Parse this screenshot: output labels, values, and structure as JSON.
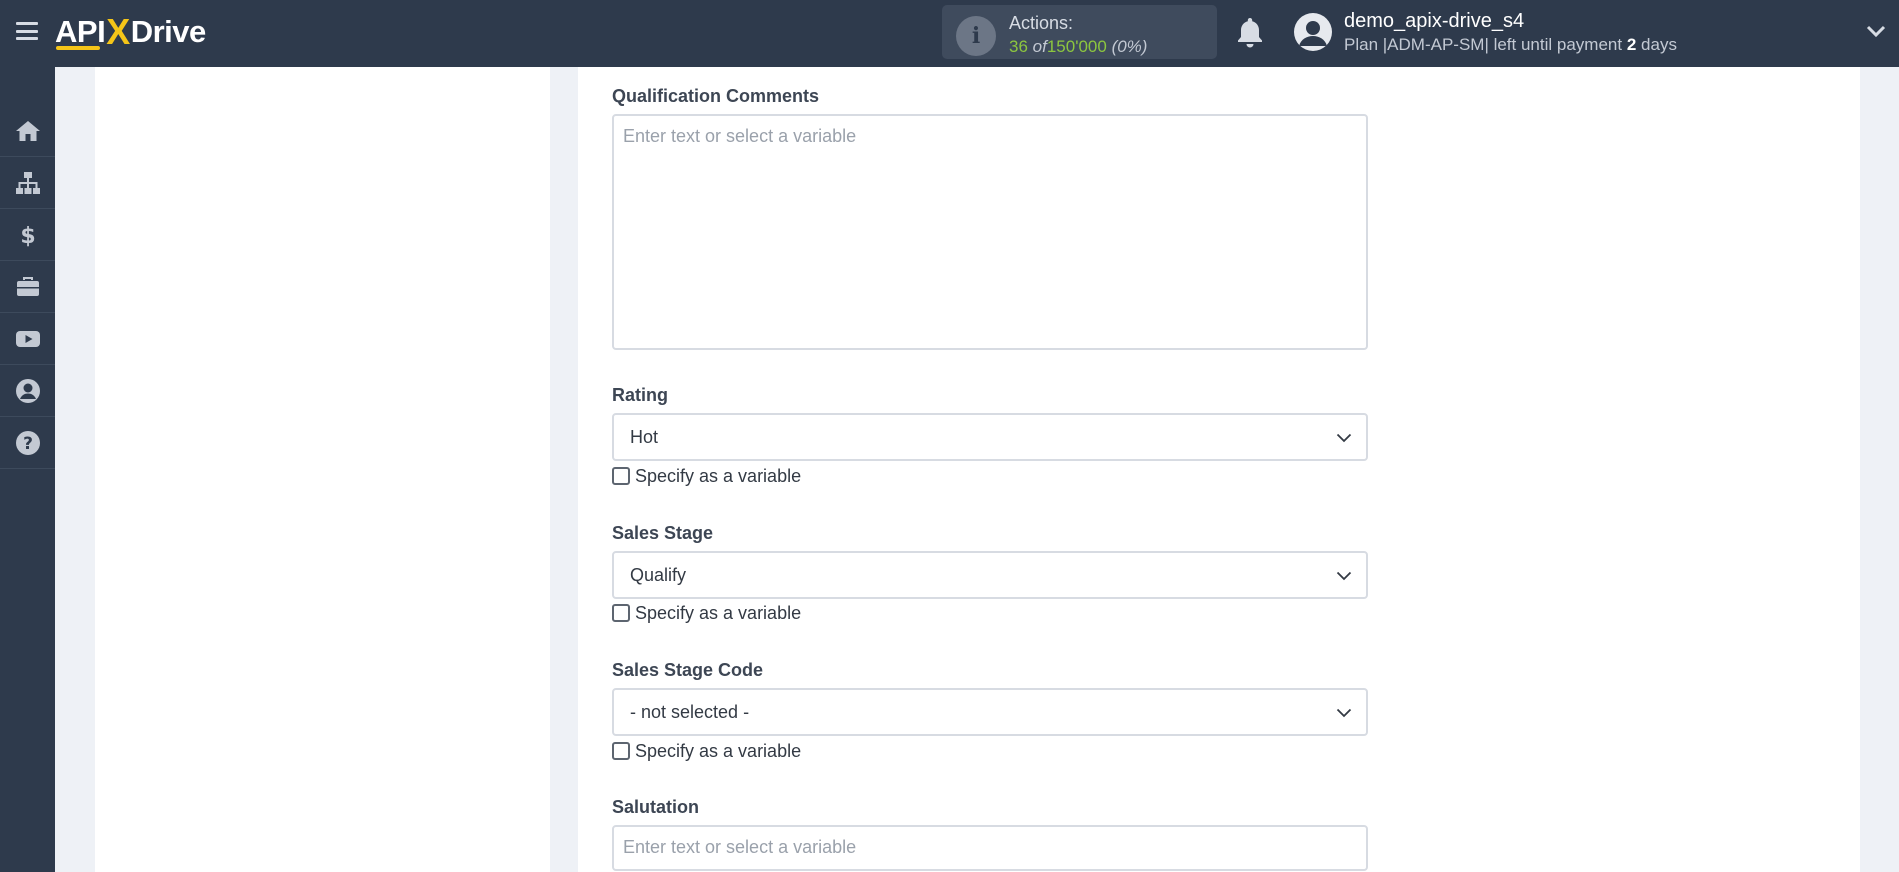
{
  "header": {
    "logo_left": "API",
    "logo_x": "X",
    "logo_right": "Drive",
    "actions": {
      "title": "Actions:",
      "used": "36",
      "of_word": "of",
      "limit": "150'000",
      "percent": "(0%)"
    },
    "user": {
      "name": "demo_apix-drive_s4",
      "plan_prefix": "Plan |ADM-AP-SM| left until payment",
      "days_num": "2",
      "days_word": "days"
    }
  },
  "sidebar": {
    "items": [
      {
        "icon": "home-icon"
      },
      {
        "icon": "sitemap-icon"
      },
      {
        "icon": "dollar-icon"
      },
      {
        "icon": "briefcase-icon"
      },
      {
        "icon": "youtube-icon"
      },
      {
        "icon": "user-circle-icon"
      },
      {
        "icon": "question-circle-icon"
      }
    ]
  },
  "form": {
    "qualification_comments": {
      "label": "Qualification Comments",
      "placeholder": "Enter text or select a variable"
    },
    "rating": {
      "label": "Rating",
      "value": "Hot",
      "checkbox_label": "Specify as a variable"
    },
    "sales_stage": {
      "label": "Sales Stage",
      "value": "Qualify",
      "checkbox_label": "Specify as a variable"
    },
    "sales_stage_code": {
      "label": "Sales Stage Code",
      "value": "- not selected -",
      "checkbox_label": "Specify as a variable"
    },
    "salutation": {
      "label": "Salutation",
      "placeholder": "Enter text or select a variable"
    }
  },
  "colors": {
    "topbar": "#2e3a4c",
    "accent_yellow": "#f5c518",
    "actions_green": "#8cc63f",
    "page_bg": "#eef1f6"
  }
}
